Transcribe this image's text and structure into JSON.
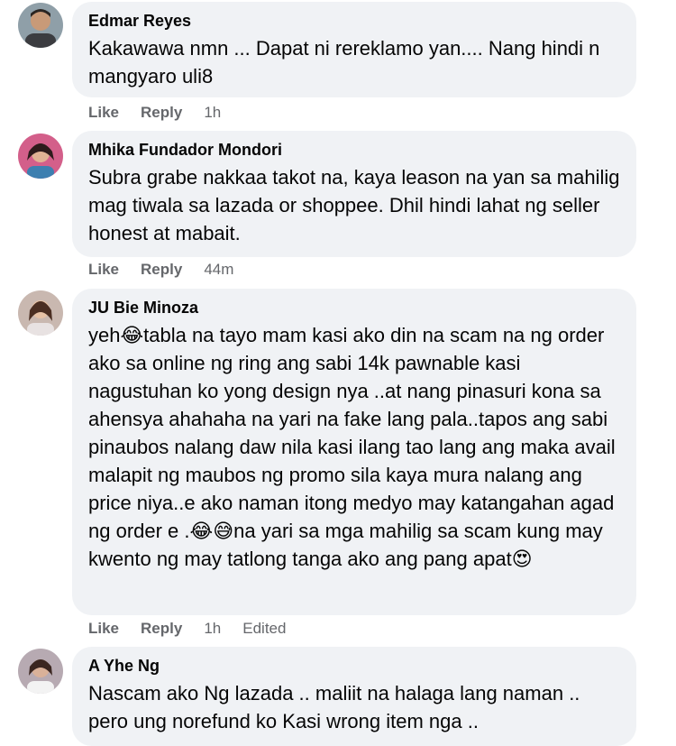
{
  "comments": [
    {
      "author": "Edmar Reyes",
      "text": "Kakawawa nmn ... Dapat ni rereklamo yan.... Nang hindi n mangyaro uli8",
      "like": "Like",
      "reply": "Reply",
      "time": "1h",
      "edited": ""
    },
    {
      "author": "Mhika Fundador Mondori",
      "text": "Subra grabe nakkaa takot na, kaya leason na yan sa mahilig mag tiwala sa lazada or shoppee. Dhil hindi lahat ng seller honest at mabait.",
      "like": "Like",
      "reply": "Reply",
      "time": "44m",
      "edited": ""
    },
    {
      "author": "JU Bie Minoza",
      "text": "yeh😂tabla na tayo mam kasi ako din na scam na ng order ako sa online ng ring ang sabi 14k pawnable kasi nagustuhan ko yong design nya ..at nang pinasuri kona sa ahensya ahahaha na yari na fake lang pala..tapos ang sabi pinaubos nalang daw nila kasi ilang tao lang ang maka avail malapit ng maubos ng promo sila kaya mura nalang ang price niya..e ako naman itong medyo may katangahan agad ng order e .😂😅na yari sa mga mahilig sa scam kung may kwento ng may tatlong tanga ako ang pang apat😍",
      "like": "Like",
      "reply": "Reply",
      "time": "1h",
      "edited": "Edited"
    },
    {
      "author": "A Yhe Ng",
      "text": "Nascam ako Ng lazada .. maliit na halaga lang naman .. pero ung norefund ko Kasi wrong item nga ..",
      "like": "Like",
      "reply": "Reply",
      "time": "",
      "edited": ""
    }
  ]
}
